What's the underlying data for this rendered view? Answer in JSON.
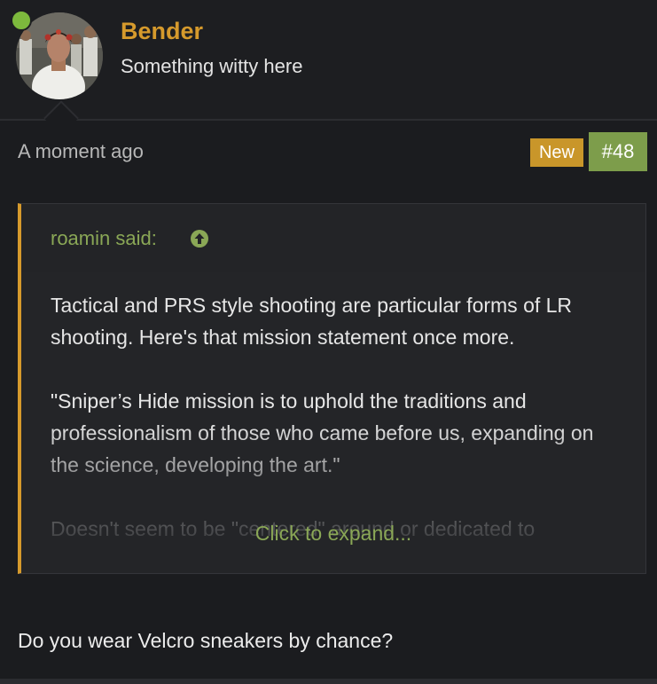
{
  "user": {
    "name": "Bender",
    "title": "Something witty here",
    "online": true
  },
  "meta": {
    "time": "A moment ago",
    "badge": "New",
    "post_number": "#48"
  },
  "quote": {
    "author_label": "roamin said:",
    "paragraphs": [
      "Tactical and PRS style shooting are particular forms of LR shooting. Here's that mission statement once more.",
      "\"Sniper’s Hide mission is to uphold the traditions and professionalism of those who came before us, expanding on the science, developing the art.\"",
      "Doesn't seem to be \"centered\" around or dedicated to"
    ],
    "expand_label": "Click to expand..."
  },
  "reply": "Do you wear Velcro sneakers by chance?",
  "colors": {
    "username": "#d69a2c",
    "badge_new": "#c9962a",
    "post_number": "#7d9d4b",
    "link": "#8aa756",
    "online": "#7db93d"
  }
}
